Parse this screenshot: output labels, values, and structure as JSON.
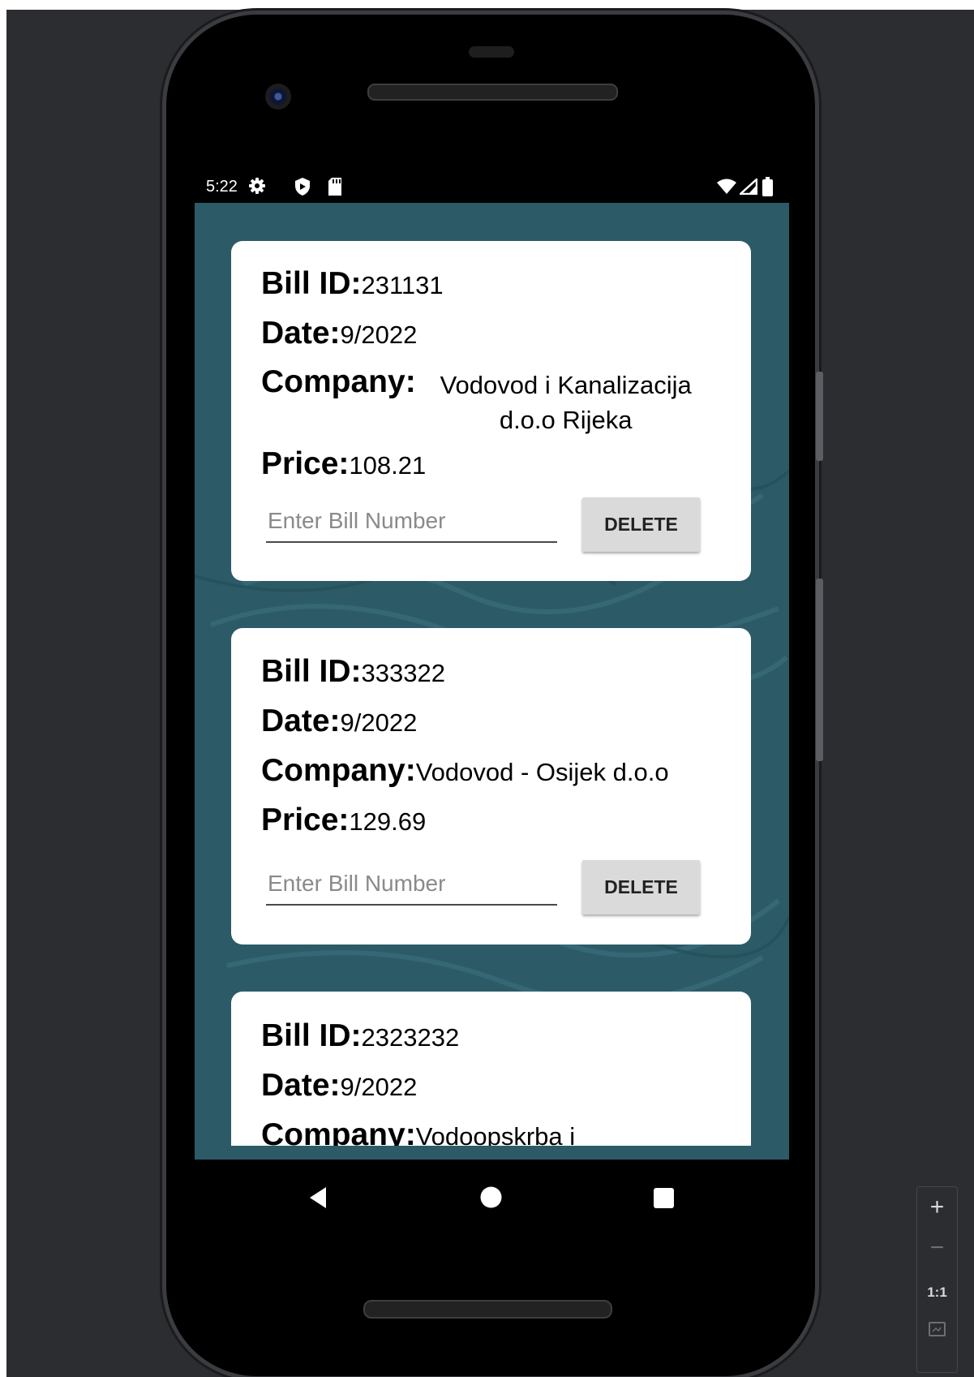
{
  "status_bar": {
    "time": "5:22",
    "left_icons": [
      "settings-icon",
      "shield-icon",
      "sd-card-icon"
    ],
    "right_icons": [
      "wifi-icon",
      "signal-icon",
      "battery-icon"
    ]
  },
  "bills": [
    {
      "id_label": "Bill ID:",
      "id_value": "231131",
      "date_label": "Date:",
      "date_value": "9/2022",
      "company_label": "Company:",
      "company_value": "Vodovod i Kanalizacija d.o.o Rijeka",
      "price_label": "Price:",
      "price_value": "108.21",
      "input_placeholder": "Enter Bill Number",
      "delete_label": "DELETE"
    },
    {
      "id_label": "Bill ID:",
      "id_value": "333322",
      "date_label": "Date:",
      "date_value": "9/2022",
      "company_label": "Company:",
      "company_value": "Vodovod - Osijek d.o.o",
      "price_label": "Price:",
      "price_value": "129.69",
      "input_placeholder": "Enter Bill Number",
      "delete_label": "DELETE"
    },
    {
      "id_label": "Bill ID:",
      "id_value": "2323232",
      "date_label": "Date:",
      "date_value": "9/2022",
      "company_label": "Company:",
      "company_value": "Vodoopskrba i"
    }
  ],
  "nav_bar": [
    "back-icon",
    "home-icon",
    "recents-icon"
  ],
  "zoom_controls": {
    "zoom_in": "+",
    "zoom_out": "−",
    "actual_size": "1:1"
  }
}
